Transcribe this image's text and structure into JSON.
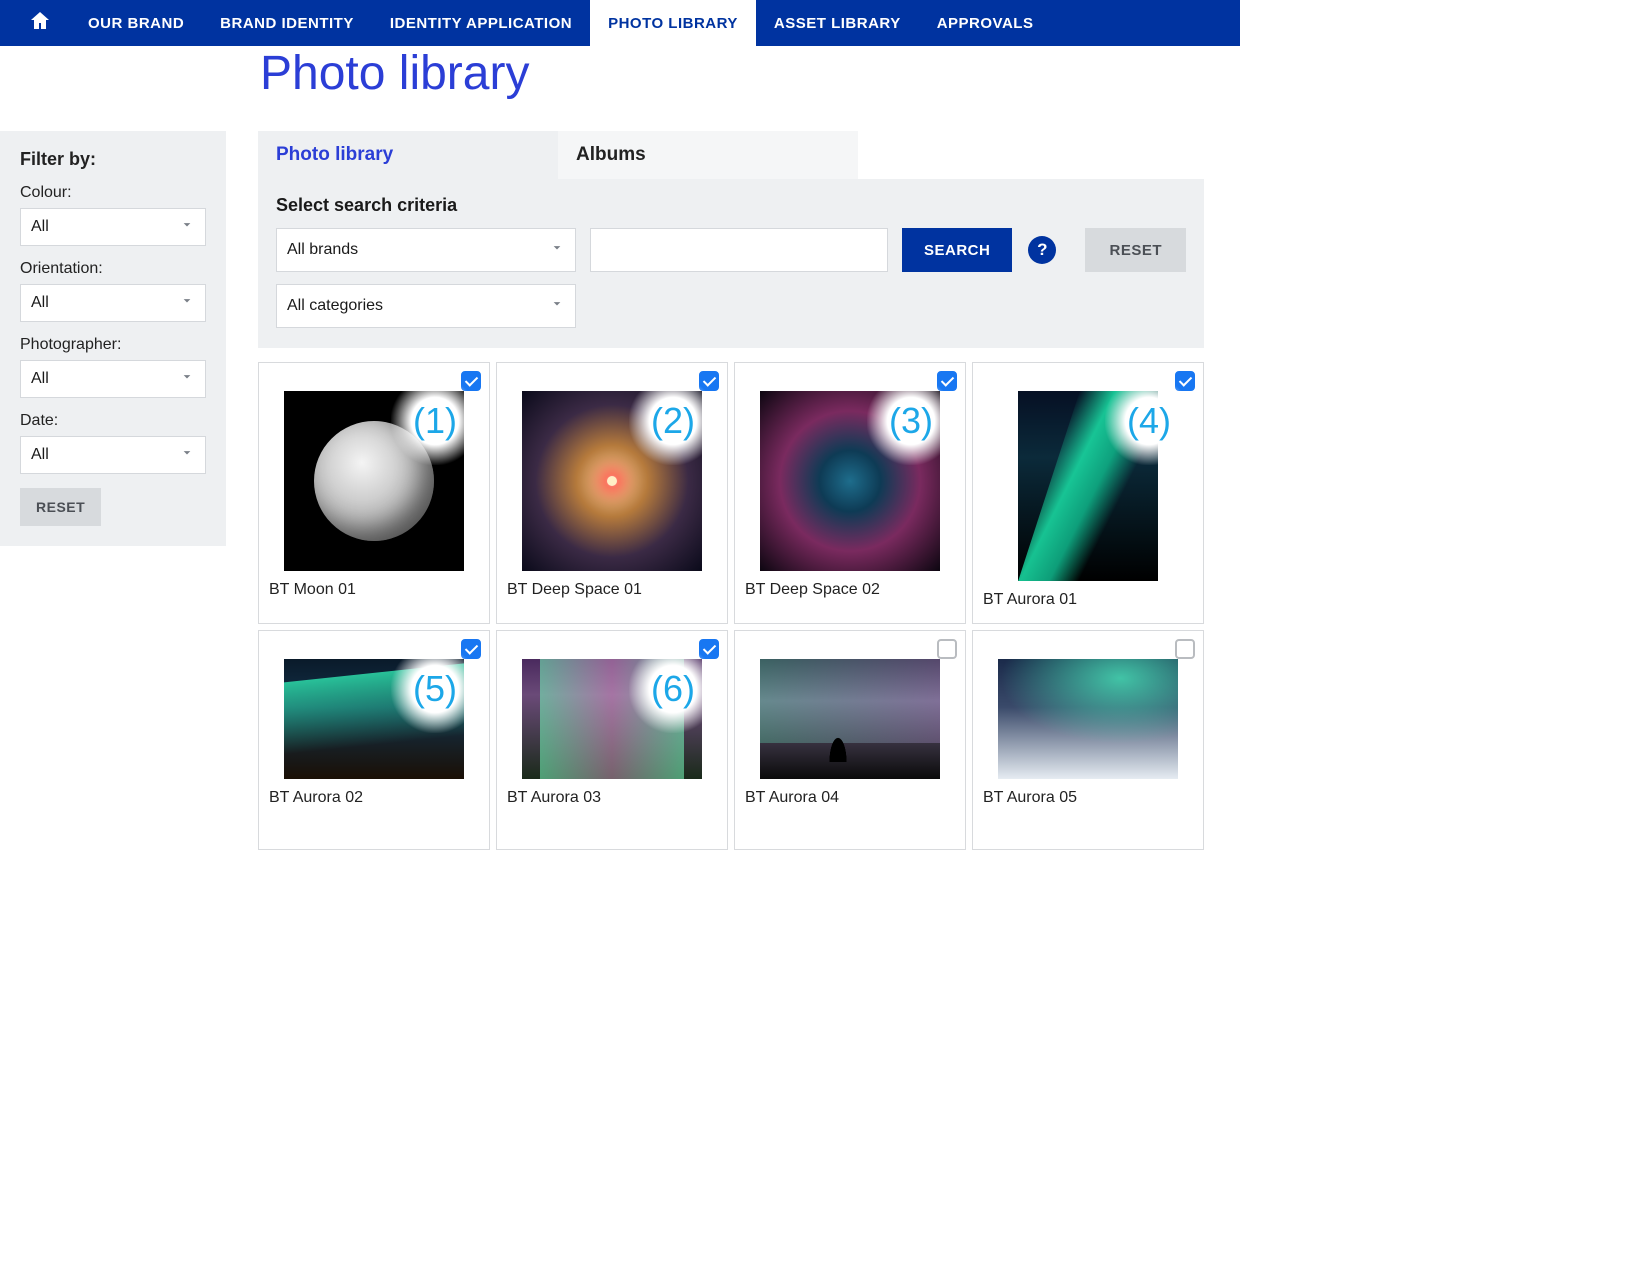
{
  "nav": {
    "items": [
      {
        "label": "OUR BRAND"
      },
      {
        "label": "BRAND IDENTITY"
      },
      {
        "label": "IDENTITY APPLICATION"
      },
      {
        "label": "PHOTO LIBRARY",
        "active": true
      },
      {
        "label": "ASSET LIBRARY"
      },
      {
        "label": "APPROVALS"
      }
    ]
  },
  "page": {
    "title": "Photo library"
  },
  "sidebar": {
    "heading": "Filter by:",
    "filters": [
      {
        "label": "Colour:",
        "value": "All"
      },
      {
        "label": "Orientation:",
        "value": "All"
      },
      {
        "label": "Photographer:",
        "value": "All"
      },
      {
        "label": "Date:",
        "value": "All"
      }
    ],
    "reset_label": "RESET"
  },
  "tabs": [
    {
      "label": "Photo library",
      "active": true
    },
    {
      "label": "Albums",
      "active": false
    }
  ],
  "search": {
    "heading": "Select search criteria",
    "brand_value": "All brands",
    "category_value": "All categories",
    "query": "",
    "search_label": "SEARCH",
    "help_label": "?",
    "reset_label": "RESET"
  },
  "results": [
    {
      "caption": "BT Moon 01",
      "badge": "(1)",
      "checked": true,
      "art": "art-moon",
      "shape": ""
    },
    {
      "caption": "BT Deep Space 01",
      "badge": "(2)",
      "checked": true,
      "art": "art-nebula1",
      "shape": ""
    },
    {
      "caption": "BT Deep Space 02",
      "badge": "(3)",
      "checked": true,
      "art": "art-nebula2",
      "shape": ""
    },
    {
      "caption": "BT Aurora 01",
      "badge": "(4)",
      "checked": true,
      "art": "art-aurora1",
      "shape": "tall"
    },
    {
      "caption": "BT Aurora 02",
      "badge": "(5)",
      "checked": true,
      "art": "art-aurora2",
      "shape": "short"
    },
    {
      "caption": "BT Aurora 03",
      "badge": "(6)",
      "checked": true,
      "art": "art-aurora3",
      "shape": "short"
    },
    {
      "caption": "BT Aurora 04",
      "badge": "",
      "checked": false,
      "art": "art-aurora4",
      "shape": "short"
    },
    {
      "caption": "BT Aurora 05",
      "badge": "",
      "checked": false,
      "art": "art-aurora5",
      "shape": "short"
    }
  ]
}
